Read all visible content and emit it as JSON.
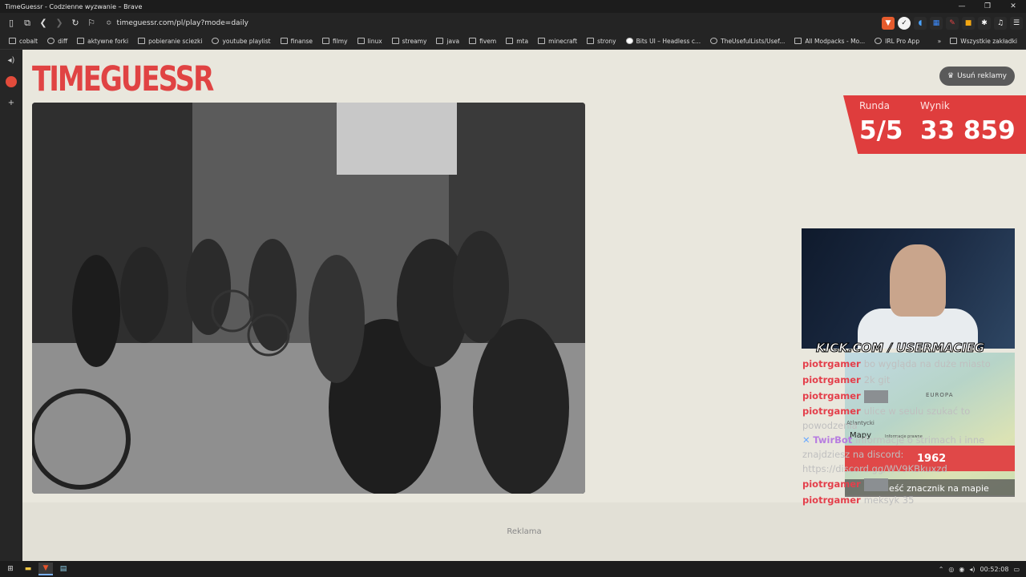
{
  "titlebar": {
    "title": "TimeGuessr - Codzienne wyzwanie – Brave",
    "minimize": "—",
    "maximize": "❐",
    "close": "✕"
  },
  "urlbar": {
    "url": "timeguessr.com/pl/play?mode=daily"
  },
  "bookmarks": [
    {
      "label": "cobalt",
      "icon": "cobalt-icon"
    },
    {
      "label": "diff",
      "icon": "diff-icon"
    },
    {
      "label": "aktywne forki",
      "icon": "fork-icon"
    },
    {
      "label": "pobieranie sciezki",
      "icon": "download-icon"
    },
    {
      "label": "youtube playlist",
      "icon": "globe-icon"
    },
    {
      "label": "finanse",
      "icon": "folder-icon"
    },
    {
      "label": "filmy",
      "icon": "folder-icon"
    },
    {
      "label": "linux",
      "icon": "folder-icon"
    },
    {
      "label": "streamy",
      "icon": "folder-icon"
    },
    {
      "label": "java",
      "icon": "folder-icon"
    },
    {
      "label": "fivem",
      "icon": "folder-icon"
    },
    {
      "label": "mta",
      "icon": "folder-icon"
    },
    {
      "label": "minecraft",
      "icon": "folder-icon"
    },
    {
      "label": "strony",
      "icon": "folder-icon"
    },
    {
      "label": "Bits UI – Headless c...",
      "icon": "bits-icon"
    },
    {
      "label": "TheUsefulLists/Usef...",
      "icon": "github-icon"
    },
    {
      "label": "All Modpacks - Mo...",
      "icon": "modpacks-icon"
    },
    {
      "label": "IRL Pro App",
      "icon": "globe-icon"
    }
  ],
  "bookmarks_more": "»",
  "bookmarks_all": "Wszystkie zakładki",
  "page": {
    "logo": "TIMEGUESSR",
    "remove_ads": "Usuń reklamy",
    "round_label": "Runda",
    "round_value": "5/5",
    "score_label": "Wynik",
    "score_value": "33 859",
    "ad_label": "Reklama"
  },
  "stream": {
    "kick_text": "KICK.COM / USERMACIEG",
    "map_region": "EUROPA",
    "map_ocean": "Atlantycki",
    "map_brand": "Mapy",
    "map_legal": "Informacje prawne",
    "year": "1962",
    "place_marker": "ieść znacznik na mapie"
  },
  "chat": [
    {
      "user": "piotrgamer",
      "text": "bo wygląda na duże miasto",
      "bot": false
    },
    {
      "user": "piotrgamer",
      "text": "2k git",
      "bot": false
    },
    {
      "user": "piotrgamer",
      "text": "",
      "emote": true,
      "bot": false
    },
    {
      "user": "piotrgamer",
      "text": "ulice w seulu szukać to powodzenia",
      "bot": false
    },
    {
      "user": "TwirBot",
      "text": "informacje o strimach i inne znajdziesz na discord: https://discord.gg/WV9KBkuxzd",
      "bot": true
    },
    {
      "user": "piotrgamer",
      "text": "",
      "emote": true,
      "bot": false
    },
    {
      "user": "piotrgamer",
      "text": "meksyk 35",
      "bot": false
    }
  ],
  "taskbar": {
    "time": "00:52:08"
  },
  "colors": {
    "brand_red": "#e04343",
    "page_bg": "#e9e7dd",
    "chat_user": "#e43f4b",
    "bot_user": "#b77de0"
  }
}
